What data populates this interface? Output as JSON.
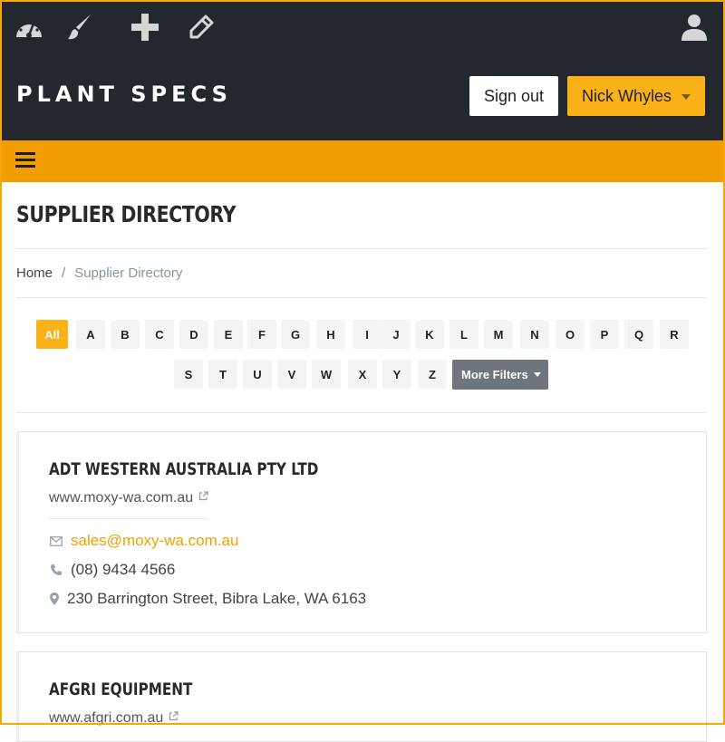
{
  "header": {
    "brand": "PLANT SPECS",
    "tools": [
      {
        "icon": "dashboard-icon"
      },
      {
        "icon": "paintbrush-icon"
      },
      {
        "icon": "plus-icon"
      },
      {
        "icon": "pencil-icon"
      }
    ],
    "user_icon": "user-icon",
    "sign_out_label": "Sign out",
    "user_name": "Nick Whyles"
  },
  "nav": {
    "menu_icon": "hamburger-menu-icon"
  },
  "page": {
    "title": "SUPPLIER DIRECTORY"
  },
  "breadcrumb": {
    "home": "Home",
    "separator": "/",
    "current": "Supplier Directory"
  },
  "filters": {
    "row1": [
      "All",
      "A",
      "B",
      "C",
      "D",
      "E",
      "F",
      "G",
      "H",
      "I",
      "J",
      "K",
      "L",
      "M",
      "N",
      "O",
      "P",
      "Q",
      "R"
    ],
    "row2": [
      "S",
      "T",
      "U",
      "V",
      "W",
      "X",
      "Y",
      "Z"
    ],
    "active": "All",
    "more_filters_label": "More Filters"
  },
  "suppliers": [
    {
      "name": "ADT WESTERN AUSTRALIA PTY LTD",
      "website": "www.moxy-wa.com.au",
      "email": "sales@moxy-wa.com.au",
      "phone": "(08) 9434 4566",
      "address": "230 Barrington Street, Bibra Lake, WA 6163"
    },
    {
      "name": "AFGRI EQUIPMENT",
      "website": "www.afgri.com.au"
    }
  ],
  "colors": {
    "header_bg": "#23272e",
    "accent": "#fbb218",
    "nav_bg": "#f29e00",
    "filter_button": "#6f757c"
  }
}
